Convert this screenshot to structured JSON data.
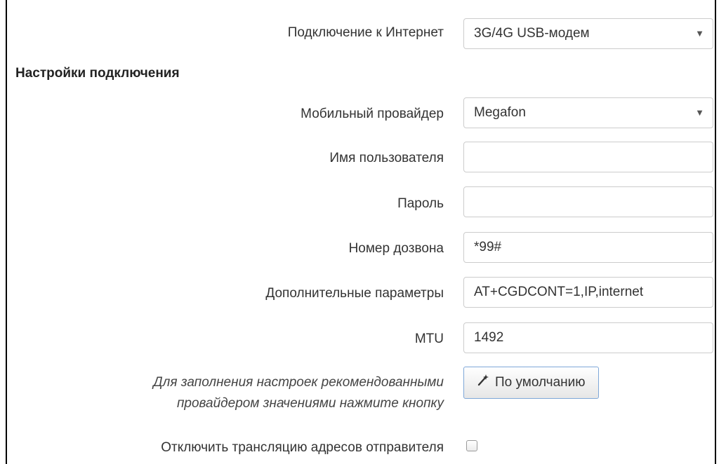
{
  "internet": {
    "label": "Подключение к Интернет",
    "value": "3G/4G USB-модем"
  },
  "section_title": "Настройки подключения",
  "fields": {
    "provider": {
      "label": "Мобильный провайдер",
      "value": "Megafon"
    },
    "username": {
      "label": "Имя пользователя",
      "value": ""
    },
    "password": {
      "label": "Пароль",
      "value": ""
    },
    "dial_number": {
      "label": "Номер дозвона",
      "value": "*99#"
    },
    "extra_params": {
      "label": "Дополнительные параметры",
      "value": "AT+CGDCONT=1,IP,internet"
    },
    "mtu": {
      "label": "MTU",
      "value": "1492"
    }
  },
  "defaults": {
    "hint_line1": "Для заполнения настроек рекомендованными",
    "hint_line2": "провайдером значениями нажмите кнопку",
    "button_label": "По умолчанию",
    "button_icon": "magic-wand-icon"
  },
  "nat": {
    "label": "Отключить трансляцию адресов отправителя",
    "checked": false
  }
}
